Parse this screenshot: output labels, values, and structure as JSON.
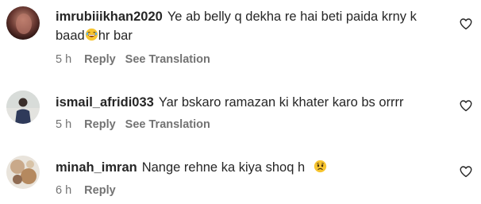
{
  "comments": [
    {
      "username": "imrubiiikhan2020",
      "text_line1": "Ye ab belly q dekha re hai beti paida krny k",
      "text_line2_before": "baad",
      "emoji": "laughing-emoji",
      "text_line2_after": "hr bar",
      "time": "5 h",
      "reply_label": "Reply",
      "translate_label": "See Translation"
    },
    {
      "username": "ismail_afridi033",
      "text": "Yar bskaro ramazan ki khater karo bs orrrr",
      "time": "5 h",
      "reply_label": "Reply",
      "translate_label": "See Translation"
    },
    {
      "username": "minah_imran",
      "text": "Nange rehne ka kiya shoq h",
      "emoji": "sad-face-emoji",
      "time": "6 h",
      "reply_label": "Reply"
    }
  ],
  "colors": {
    "text": "#262626",
    "meta": "#737373",
    "background": "#ffffff"
  },
  "icons": [
    "heart-outline-icon"
  ]
}
